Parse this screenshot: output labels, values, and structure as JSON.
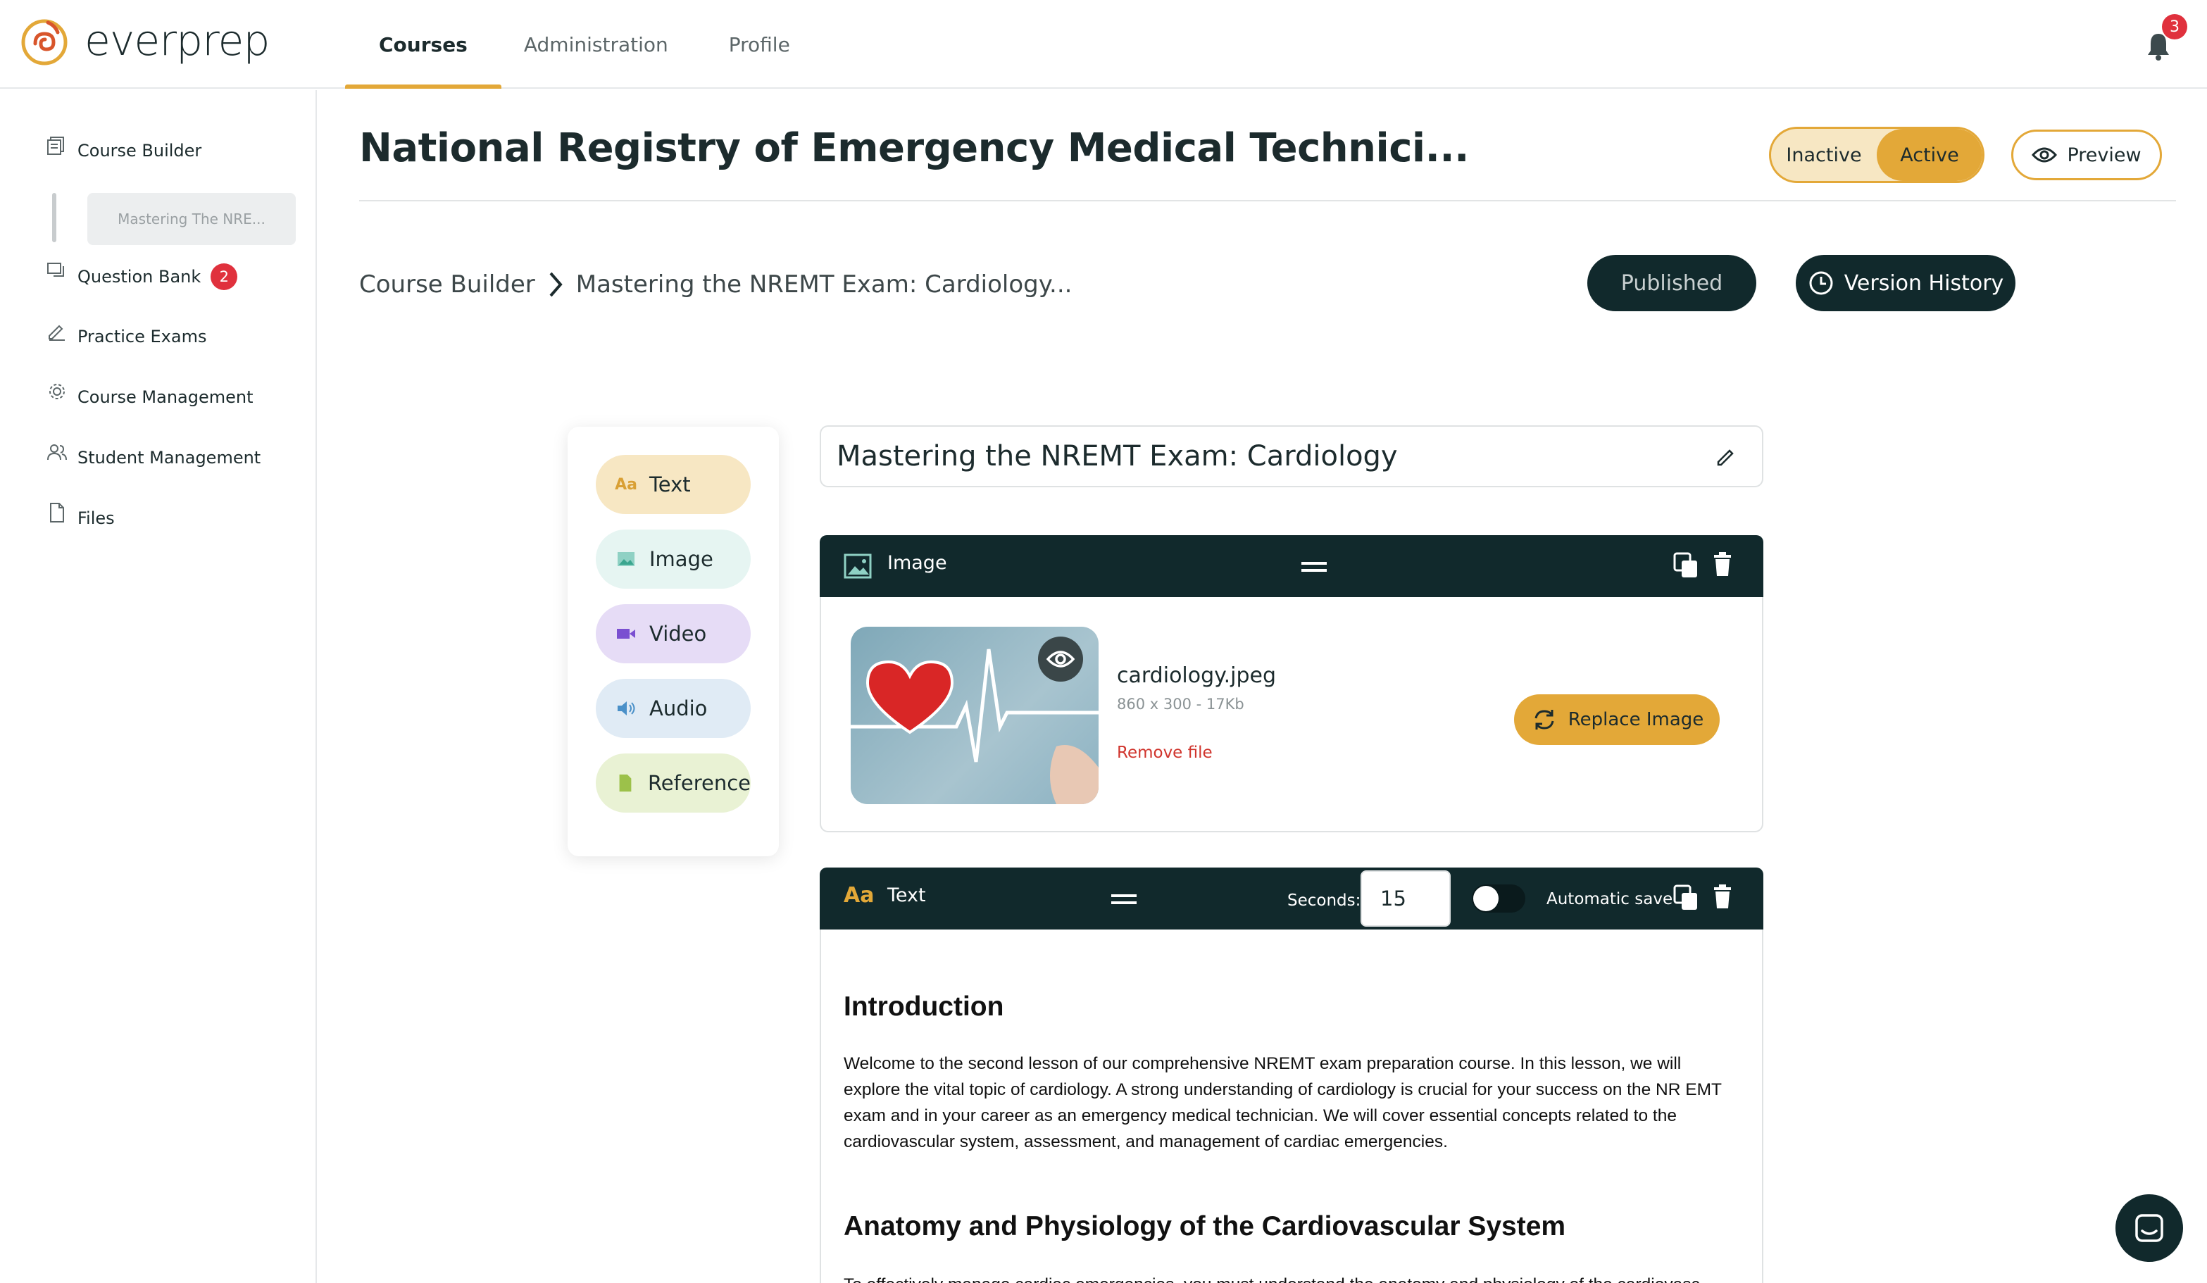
{
  "app": {
    "name": "everprep"
  },
  "nav": {
    "tabs": [
      {
        "label": "Courses"
      },
      {
        "label": "Administration"
      },
      {
        "label": "Profile"
      }
    ]
  },
  "notifications": {
    "count": "3"
  },
  "sidebar": {
    "items": [
      {
        "label": "Course Builder",
        "icon": "course-builder-icon"
      },
      {
        "label": "Question Bank",
        "icon": "question-bank-icon",
        "badge": "2"
      },
      {
        "label": "Practice Exams",
        "icon": "pencil-icon"
      },
      {
        "label": "Course Management",
        "icon": "gear-icon"
      },
      {
        "label": "Student Management",
        "icon": "users-icon"
      },
      {
        "label": "Files",
        "icon": "file-icon"
      }
    ],
    "sub_item": "Mastering The NRE..."
  },
  "page": {
    "title": "National Registry of Emergency Medical Technici...",
    "status_toggle": {
      "inactive": "Inactive",
      "active": "Active",
      "selected": "Active"
    },
    "preview_label": "Preview",
    "breadcrumb": {
      "root": "Course Builder",
      "current": "Mastering the NREMT Exam: Cardiology..."
    },
    "published_label": "Published",
    "version_history_label": "Version History"
  },
  "palette": {
    "items": [
      {
        "label": "Text",
        "icon": "text-icon",
        "color": "#f7e7c3"
      },
      {
        "label": "Image",
        "icon": "image-icon",
        "color": "#e6f5f2"
      },
      {
        "label": "Video",
        "icon": "video-icon",
        "color": "#e6dcf6"
      },
      {
        "label": "Audio",
        "icon": "audio-icon",
        "color": "#e0ebf5"
      },
      {
        "label": "Reference",
        "icon": "reference-icon",
        "color": "#e9f2d4"
      }
    ],
    "text_glyph": "Aa"
  },
  "lesson": {
    "title": "Mastering the NREMT Exam: Cardiology",
    "image_block": {
      "label": "Image",
      "file_name": "cardiology.jpeg",
      "file_meta": "860 x 300 - 17Kb",
      "remove_label": "Remove file",
      "replace_label": "Replace Image"
    },
    "text_block": {
      "label": "Text",
      "icon_glyph": "Aa",
      "seconds_label": "Seconds:",
      "seconds_value": "15",
      "autosave_label": "Automatic save",
      "autosave_on": false,
      "content": {
        "h1": "Introduction",
        "p1": "Welcome to the second lesson of our comprehensive NREMT exam preparation course. In this lesson, we will explore the vital topic of cardiology. A strong understanding of cardiology is crucial for your success on the NR EMT exam and in your career as an emergency medical technician. We will cover essential concepts related to the cardiovascular system, assessment, and management of cardiac emergencies.",
        "h2": "Anatomy and Physiology of the Cardiovascular System",
        "p2": "To effectively manage cardiac emergencies, you must understand the anatomy and physiology of the cardiovasc"
      }
    }
  },
  "colors": {
    "accent": "#e3a838",
    "dark": "#11292c",
    "danger": "#d0342c"
  }
}
